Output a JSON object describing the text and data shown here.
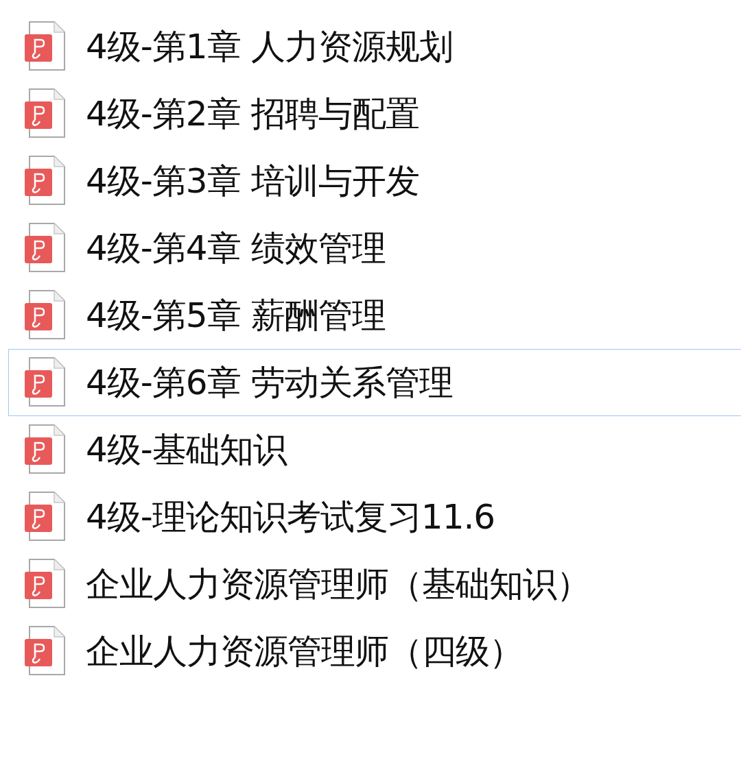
{
  "files": [
    {
      "name": "4级-第1章 人力资源规划",
      "selected": false
    },
    {
      "name": "4级-第2章 招聘与配置",
      "selected": false
    },
    {
      "name": "4级-第3章 培训与开发",
      "selected": false
    },
    {
      "name": "4级-第4章 绩效管理",
      "selected": false
    },
    {
      "name": "4级-第5章 薪酬管理",
      "selected": false
    },
    {
      "name": "4级-第6章 劳动关系管理",
      "selected": true
    },
    {
      "name": "4级-基础知识",
      "selected": false
    },
    {
      "name": "4级-理论知识考试复习11.6",
      "selected": false
    },
    {
      "name": "企业人力资源管理师（基础知识）",
      "selected": false
    },
    {
      "name": "企业人力资源管理师（四级）",
      "selected": false
    }
  ]
}
